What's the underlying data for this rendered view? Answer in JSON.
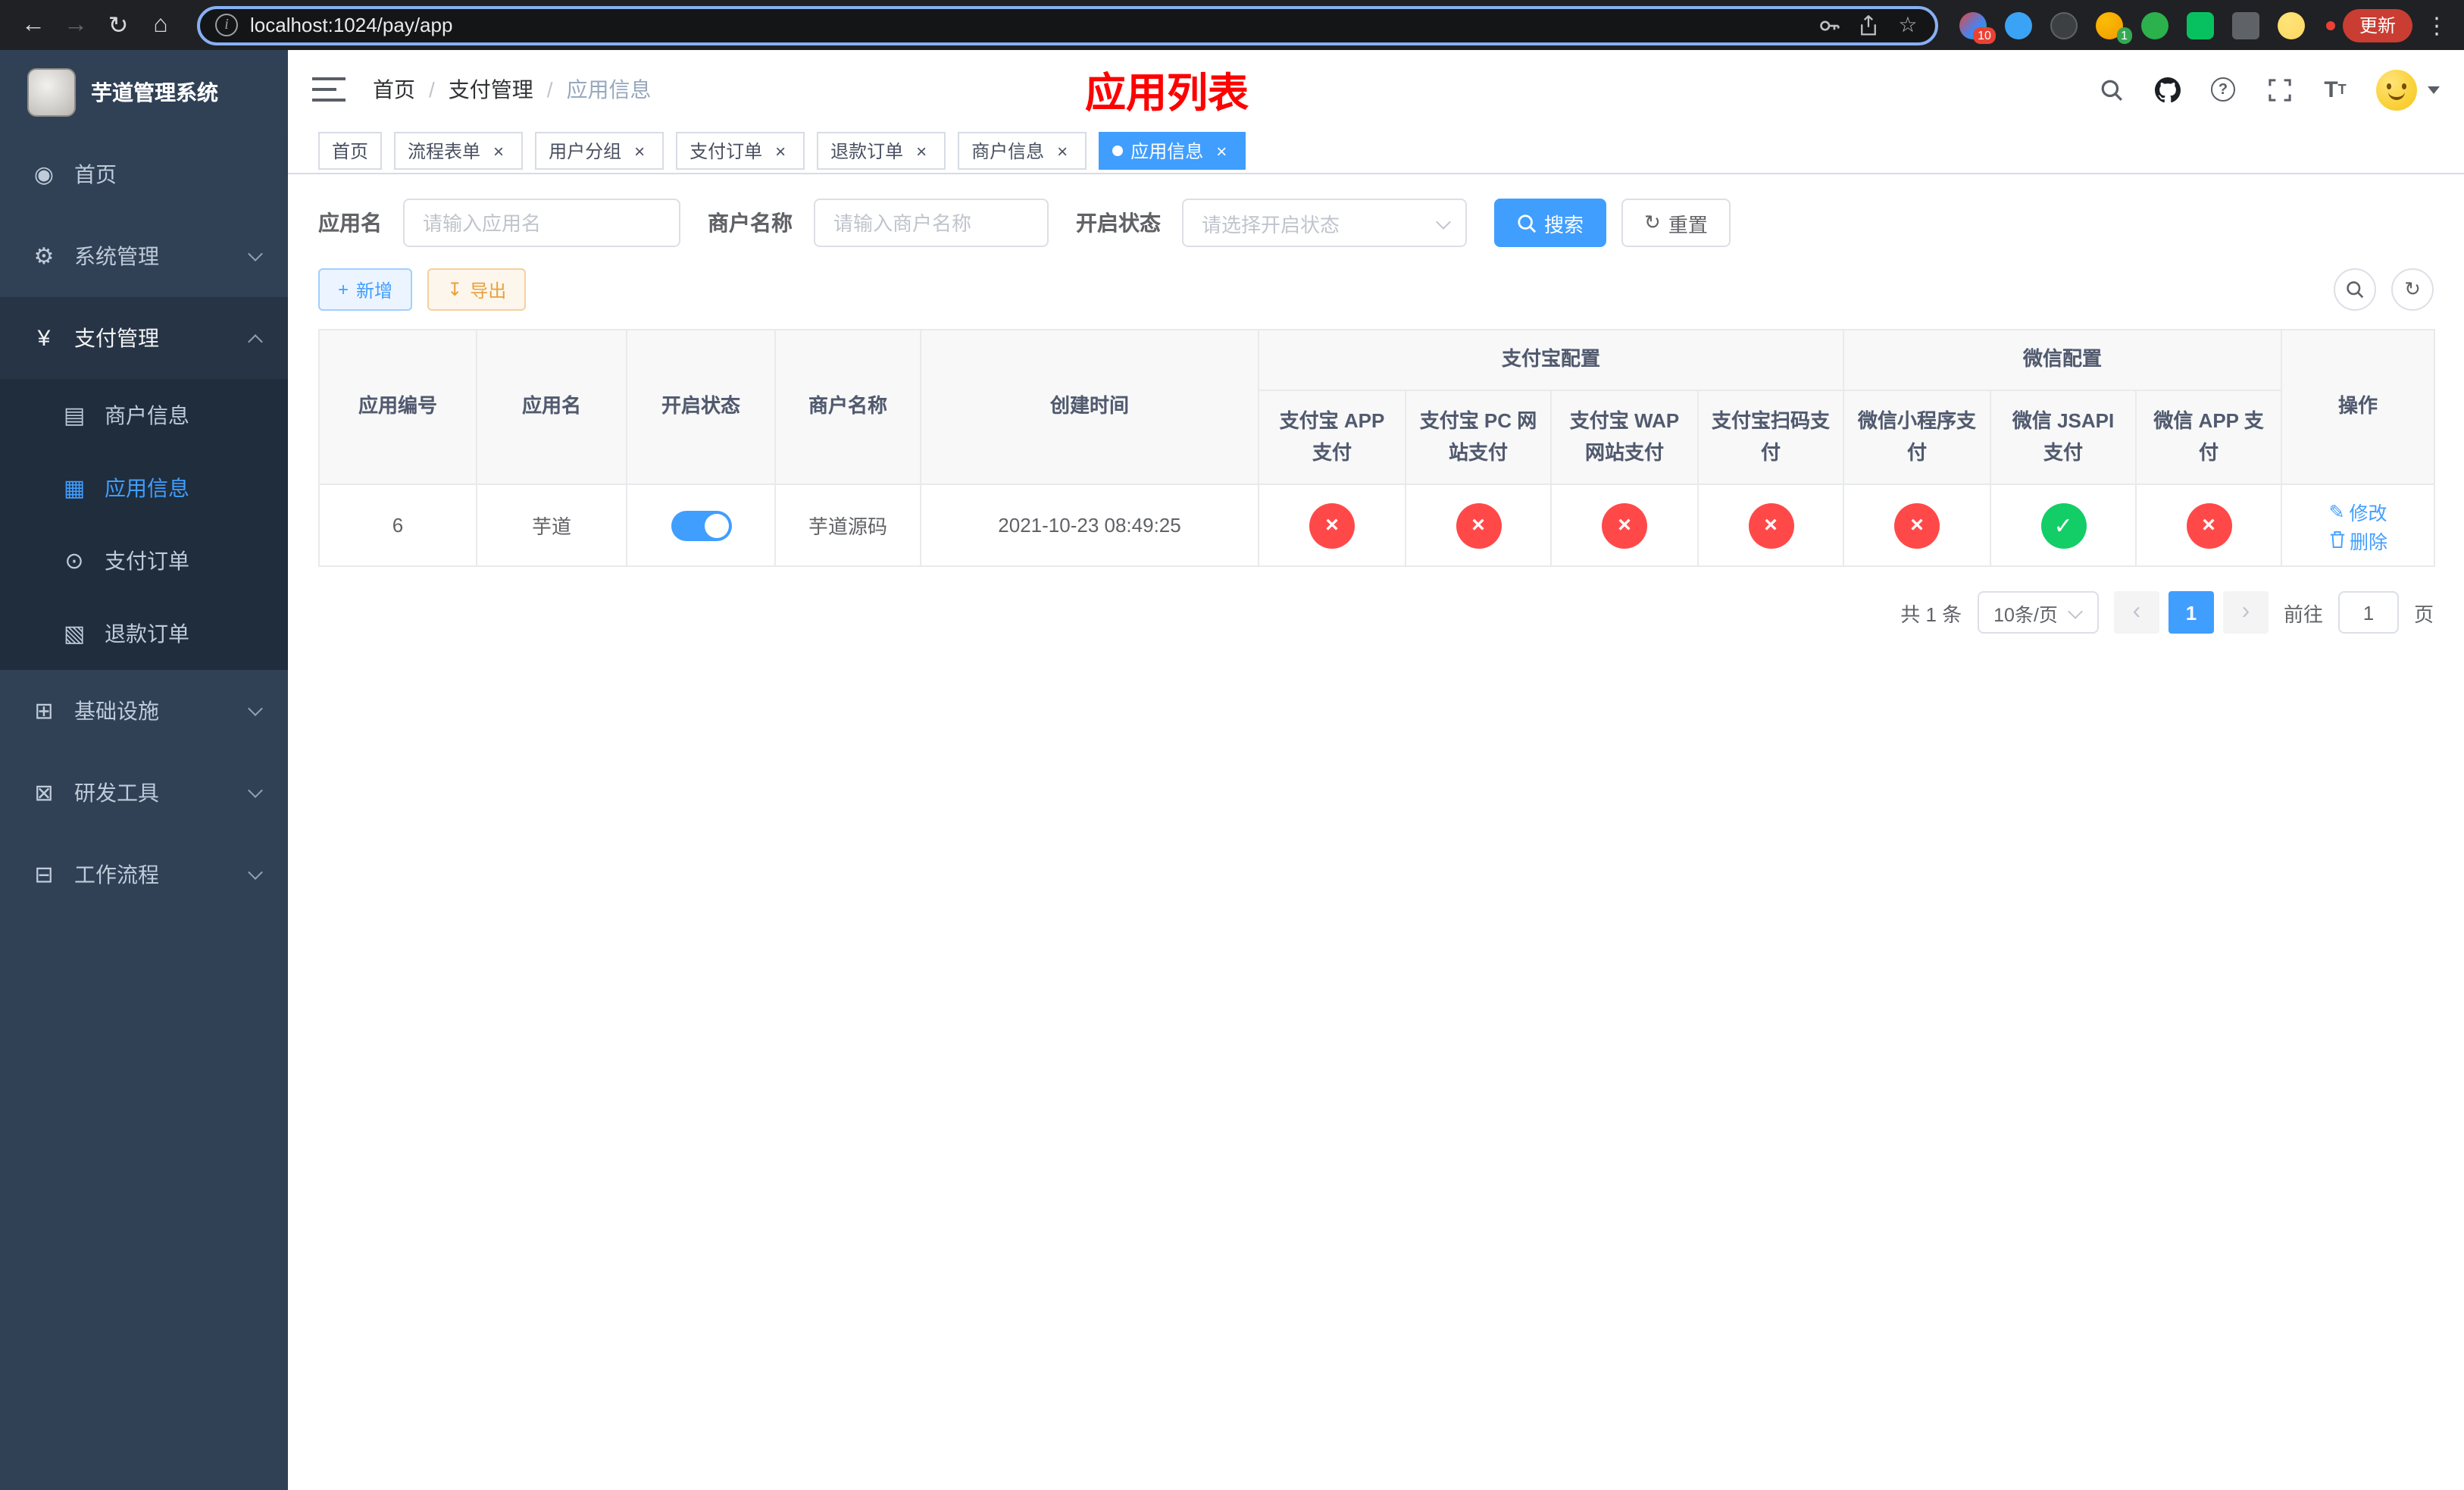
{
  "browser": {
    "url": "localhost:1024/pay/app",
    "update_label": "更新",
    "ext_badge_red": "10",
    "ext_badge_green": "1"
  },
  "icons": {
    "back": "←",
    "forward": "→",
    "reload": "↻",
    "home": "⌂",
    "star": "☆",
    "more": "⋮",
    "menu_home": "◉",
    "menu_system": "⚙",
    "menu_pay": "¥",
    "menu_merchant": "▤",
    "menu_app": "▦",
    "menu_order": "⊙",
    "menu_refund": "▧",
    "menu_infra": "⊞",
    "menu_tools": "⊠",
    "menu_flow": "⊟",
    "question": "?",
    "font_size_big": "T",
    "font_size_small": "T",
    "plus": "+",
    "download": "↧",
    "refresh": "↻",
    "edit": "✎",
    "prev": "‹",
    "next": "›",
    "tab_close": "×"
  },
  "sidebar": {
    "title": "芋道管理系统",
    "items": [
      {
        "label": "首页"
      },
      {
        "label": "系统管理"
      },
      {
        "label": "支付管理",
        "children": [
          {
            "label": "商户信息"
          },
          {
            "label": "应用信息"
          },
          {
            "label": "支付订单"
          },
          {
            "label": "退款订单"
          }
        ]
      },
      {
        "label": "基础设施"
      },
      {
        "label": "研发工具"
      },
      {
        "label": "工作流程"
      }
    ]
  },
  "header": {
    "breadcrumb": [
      "首页",
      "支付管理",
      "应用信息"
    ],
    "page_title": "应用列表"
  },
  "tags": [
    {
      "label": "首页"
    },
    {
      "label": "流程表单"
    },
    {
      "label": "用户分组"
    },
    {
      "label": "支付订单"
    },
    {
      "label": "退款订单"
    },
    {
      "label": "商户信息"
    },
    {
      "label": "应用信息"
    }
  ],
  "filters": {
    "app_name_label": "应用名",
    "app_name_placeholder": "请输入应用名",
    "merchant_label": "商户名称",
    "merchant_placeholder": "请输入商户名称",
    "status_label": "开启状态",
    "status_placeholder": "请选择开启状态",
    "search_label": "搜索",
    "reset_label": "重置"
  },
  "toolbar": {
    "add_label": "新增",
    "export_label": "导出"
  },
  "table": {
    "simple_columns": [
      "应用编号",
      "应用名",
      "开启状态",
      "商户名称",
      "创建时间"
    ],
    "alipay_group": "支付宝配置",
    "wechat_group": "微信配置",
    "alipay_columns": [
      "支付宝 APP 支付",
      "支付宝 PC 网站支付",
      "支付宝 WAP 网站支付",
      "支付宝扫码支付"
    ],
    "wechat_columns": [
      "微信小程序支付",
      "微信 JSAPI 支付",
      "微信 APP 支付"
    ],
    "action_column": "操作",
    "rows": [
      {
        "app_id": "6",
        "app_name": "芋道",
        "enabled": true,
        "merchant_name": "芋道源码",
        "create_time": "2021-10-23 08:49:25",
        "statuses": {
          "alipay_app": false,
          "alipay_pc": false,
          "alipay_wap": false,
          "alipay_qr": false,
          "wechat_mini": false,
          "wechat_jsapi": true,
          "wechat_app": false
        },
        "edit_label": "修改",
        "delete_label": "删除"
      }
    ]
  },
  "pagination": {
    "total_text": "共 1 条",
    "page_size_text": "10条/页",
    "page": "1",
    "goto_label": "前往",
    "goto_value": "1",
    "unit_label": "页"
  }
}
